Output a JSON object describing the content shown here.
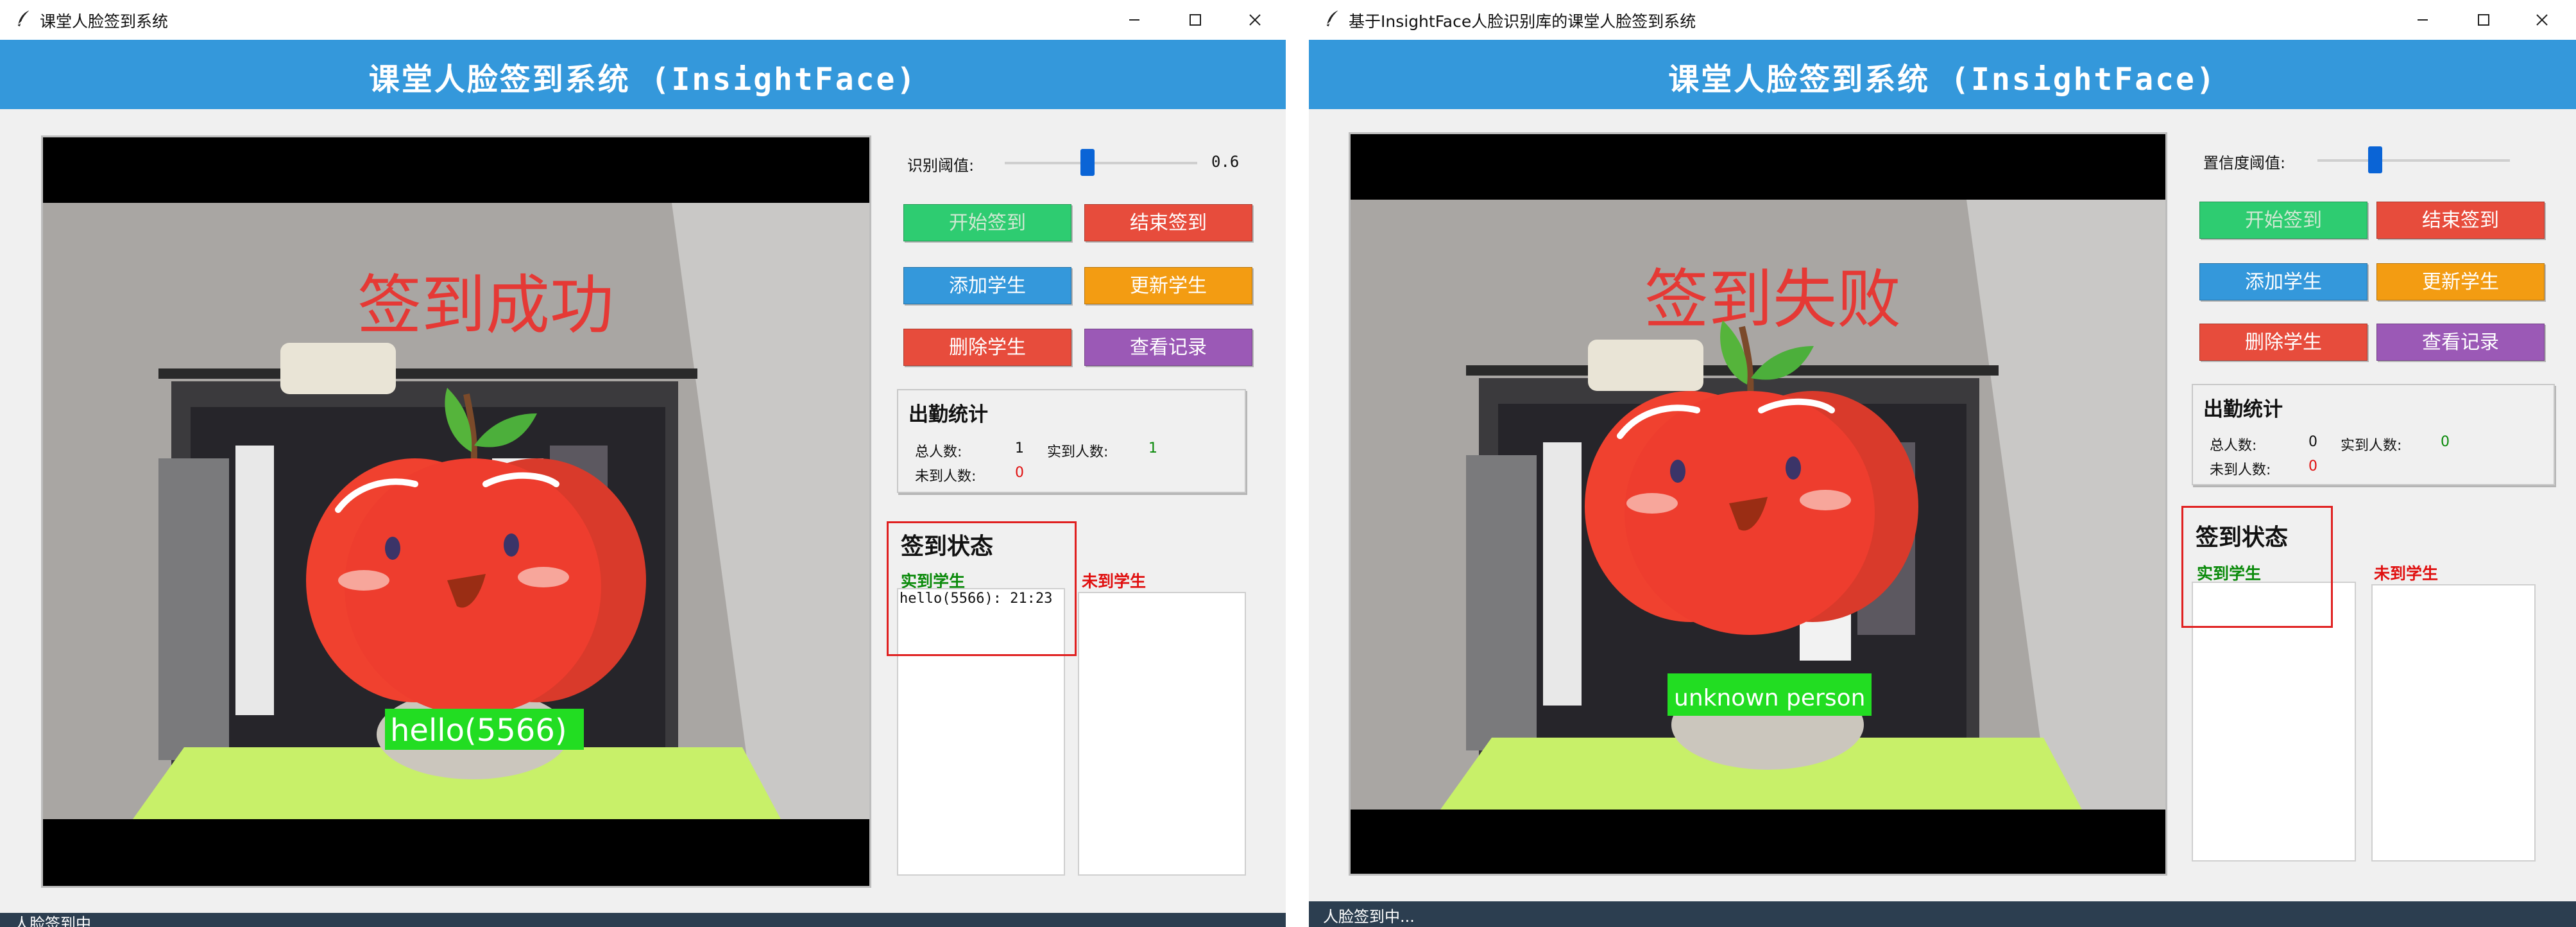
{
  "colors": {
    "header": "#3498db",
    "start": "#2ecc71",
    "stop": "#e74c3c",
    "add": "#3498db",
    "update": "#f39c12",
    "delete": "#e74c3c",
    "records": "#9b59b6",
    "present": "#0a8a0a",
    "absent": "#e01010",
    "statusbar": "#2c3e50"
  },
  "windows": [
    {
      "title": "课堂人脸签到系统",
      "header": "课堂人脸签到系统 (InsightFace)",
      "overlay_text": "签到成功",
      "face_label": "hello(5566)",
      "threshold_label": "识别阈值:",
      "threshold_value": "0.6",
      "threshold_level": 0.43,
      "buttons": {
        "start": "开始签到",
        "stop": "结束签到",
        "add": "添加学生",
        "update": "更新学生",
        "delete": "删除学生",
        "records": "查看记录"
      },
      "stats": {
        "title": "出勤统计",
        "total_label": "总人数:",
        "total": "1",
        "present_label": "实到人数:",
        "present": "1",
        "absent_label": "未到人数:",
        "absent": "0"
      },
      "status_title": "签到状态",
      "present_col": "实到学生",
      "absent_col": "未到学生",
      "present_list": [
        "hello(5566): 21:23"
      ],
      "statusbar": "人脸签到中..."
    },
    {
      "title": "基于InsightFace人脸识别库的课堂人脸签到系统",
      "header": "课堂人脸签到系统 (InsightFace)",
      "overlay_text": "签到失败",
      "face_label": "unknown person",
      "threshold_label": "置信度阈值:",
      "threshold_value": "",
      "threshold_level": 0.3,
      "buttons": {
        "start": "开始签到",
        "stop": "结束签到",
        "add": "添加学生",
        "update": "更新学生",
        "delete": "删除学生",
        "records": "查看记录"
      },
      "stats": {
        "title": "出勤统计",
        "total_label": "总人数:",
        "total": "0",
        "present_label": "实到人数:",
        "present": "0",
        "absent_label": "未到人数:",
        "absent": "0"
      },
      "status_title": "签到状态",
      "present_col": "实到学生",
      "absent_col": "未到学生",
      "present_list": [],
      "statusbar": "人脸签到中..."
    }
  ],
  "icons": [
    "feather-icon",
    "minimize-icon",
    "maximize-icon",
    "close-icon"
  ]
}
